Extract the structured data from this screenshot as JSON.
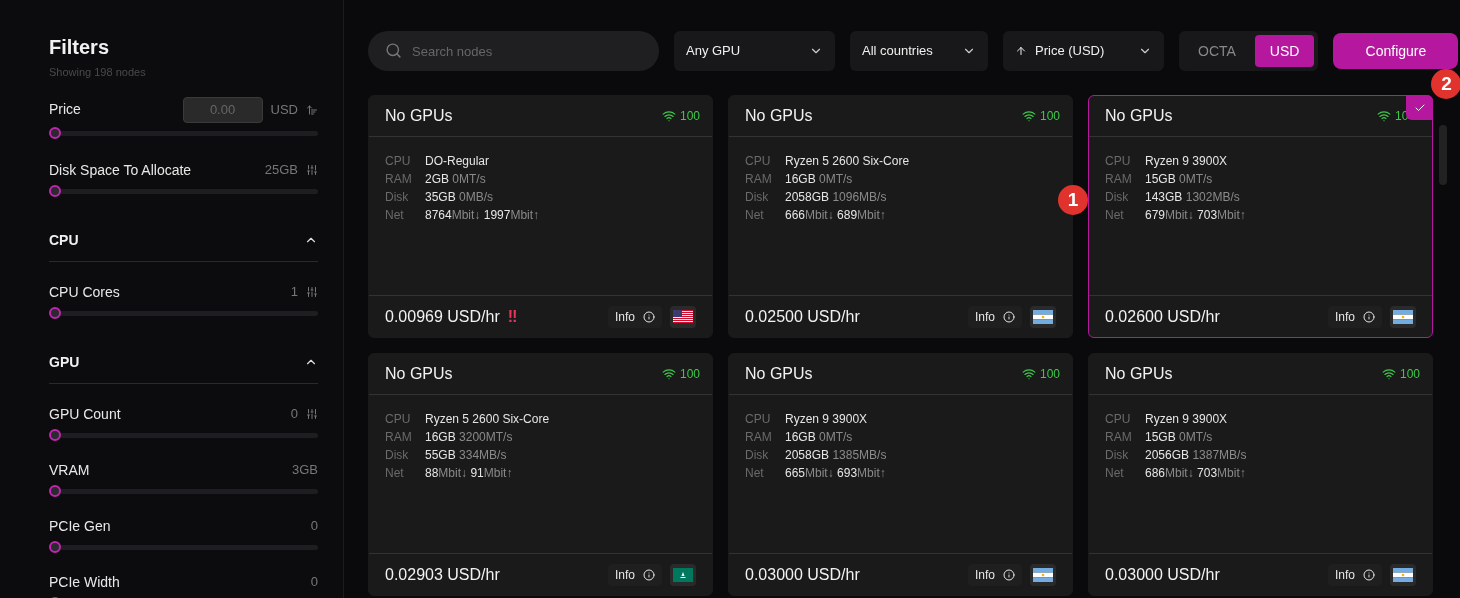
{
  "filters": {
    "title": "Filters",
    "subtitle": "Showing 198 nodes",
    "items": [
      {
        "kind": "price",
        "label": "Price",
        "placeholder": "0.00",
        "unit": "USD",
        "level": 0
      },
      {
        "kind": "slider",
        "label": "Disk Space To Allocate",
        "value": "25GB",
        "tune": true,
        "level": 0
      },
      {
        "kind": "section",
        "label": "CPU",
        "expanded": true
      },
      {
        "kind": "slider",
        "label": "CPU Cores",
        "value": "1",
        "tune": true,
        "level": 0
      },
      {
        "kind": "section",
        "label": "GPU",
        "expanded": true
      },
      {
        "kind": "slider",
        "label": "GPU Count",
        "value": "0",
        "tune": true,
        "level": 0
      },
      {
        "kind": "slider",
        "label": "VRAM",
        "value": "3GB",
        "tune": false,
        "level": 0
      },
      {
        "kind": "slider",
        "label": "PCIe Gen",
        "value": "0",
        "tune": false,
        "level": 0
      },
      {
        "kind": "slider",
        "label": "PCIe Width",
        "value": "0",
        "tune": false,
        "level": 0
      }
    ]
  },
  "toolbar": {
    "search": {
      "placeholder": "Search nodes"
    },
    "dropdowns": [
      {
        "label": "Any GPU",
        "sort": false
      },
      {
        "label": "All countries",
        "sort": false
      },
      {
        "label": "Price (USD)",
        "sort": true
      }
    ],
    "currency": [
      {
        "label": "OCTA",
        "selected": false
      },
      {
        "label": "USD",
        "selected": true
      }
    ],
    "configure": {
      "label": "Configure",
      "marker": "2"
    }
  },
  "nodes": [
    {
      "title": "No GPUs",
      "signal": "100",
      "selected": false,
      "cpu": [
        "CPU",
        "DO-Regular"
      ],
      "ram": [
        "RAM",
        "2GB",
        "0MT/s"
      ],
      "disk": [
        "Disk",
        "35GB",
        "0MB/s"
      ],
      "net": [
        "Net",
        "8764",
        "Mbit↓",
        "1997",
        "Mbit↑"
      ],
      "price": "0.00969 USD/hr",
      "alert": "‼",
      "info": "Info",
      "flag": {
        "kind": "us"
      }
    },
    {
      "title": "No GPUs",
      "signal": "100",
      "selected": false,
      "cpu": [
        "CPU",
        "Ryzen 5 2600 Six-Core"
      ],
      "ram": [
        "RAM",
        "16GB",
        "0MT/s"
      ],
      "disk": [
        "Disk",
        "2058GB",
        "1096MB/s"
      ],
      "net": [
        "Net",
        "666",
        "Mbit↓",
        "689",
        "Mbit↑"
      ],
      "price": "0.02500 USD/hr",
      "info": "Info",
      "flag": {
        "kind": "ar"
      }
    },
    {
      "title": "No GPUs",
      "signal": "10",
      "selected": true,
      "marker": "1",
      "cpu": [
        "CPU",
        "Ryzen 9 3900X"
      ],
      "ram": [
        "RAM",
        "15GB",
        "0MT/s"
      ],
      "disk": [
        "Disk",
        "143GB",
        "1302MB/s"
      ],
      "net": [
        "Net",
        "679",
        "Mbit↓",
        "703",
        "Mbit↑"
      ],
      "price": "0.02600 USD/hr",
      "info": "Info",
      "flag": {
        "kind": "ar"
      }
    },
    {
      "title": "No GPUs",
      "signal": "100",
      "selected": false,
      "cpu": [
        "CPU",
        "Ryzen 5 2600 Six-Core"
      ],
      "ram": [
        "RAM",
        "16GB",
        "3200MT/s"
      ],
      "disk": [
        "Disk",
        "55GB",
        "334MB/s"
      ],
      "net": [
        "Net",
        "88",
        "Mbit↓",
        "91",
        "Mbit↑"
      ],
      "price": "0.02903 USD/hr",
      "info": "Info",
      "flag": {
        "kind": "mo"
      }
    },
    {
      "title": "No GPUs",
      "signal": "100",
      "selected": false,
      "cpu": [
        "CPU",
        "Ryzen 9 3900X"
      ],
      "ram": [
        "RAM",
        "16GB",
        "0MT/s"
      ],
      "disk": [
        "Disk",
        "2058GB",
        "1385MB/s"
      ],
      "net": [
        "Net",
        "665",
        "Mbit↓",
        "693",
        "Mbit↑"
      ],
      "price": "0.03000 USD/hr",
      "info": "Info",
      "flag": {
        "kind": "ar"
      }
    },
    {
      "title": "No GPUs",
      "signal": "100",
      "selected": false,
      "cpu": [
        "CPU",
        "Ryzen 9 3900X"
      ],
      "ram": [
        "RAM",
        "15GB",
        "0MT/s"
      ],
      "disk": [
        "Disk",
        "2056GB",
        "1387MB/s"
      ],
      "net": [
        "Net",
        "686",
        "Mbit↓",
        "703",
        "Mbit↑"
      ],
      "price": "0.03000 USD/hr",
      "info": "Info",
      "flag": {
        "kind": "ar"
      }
    }
  ]
}
